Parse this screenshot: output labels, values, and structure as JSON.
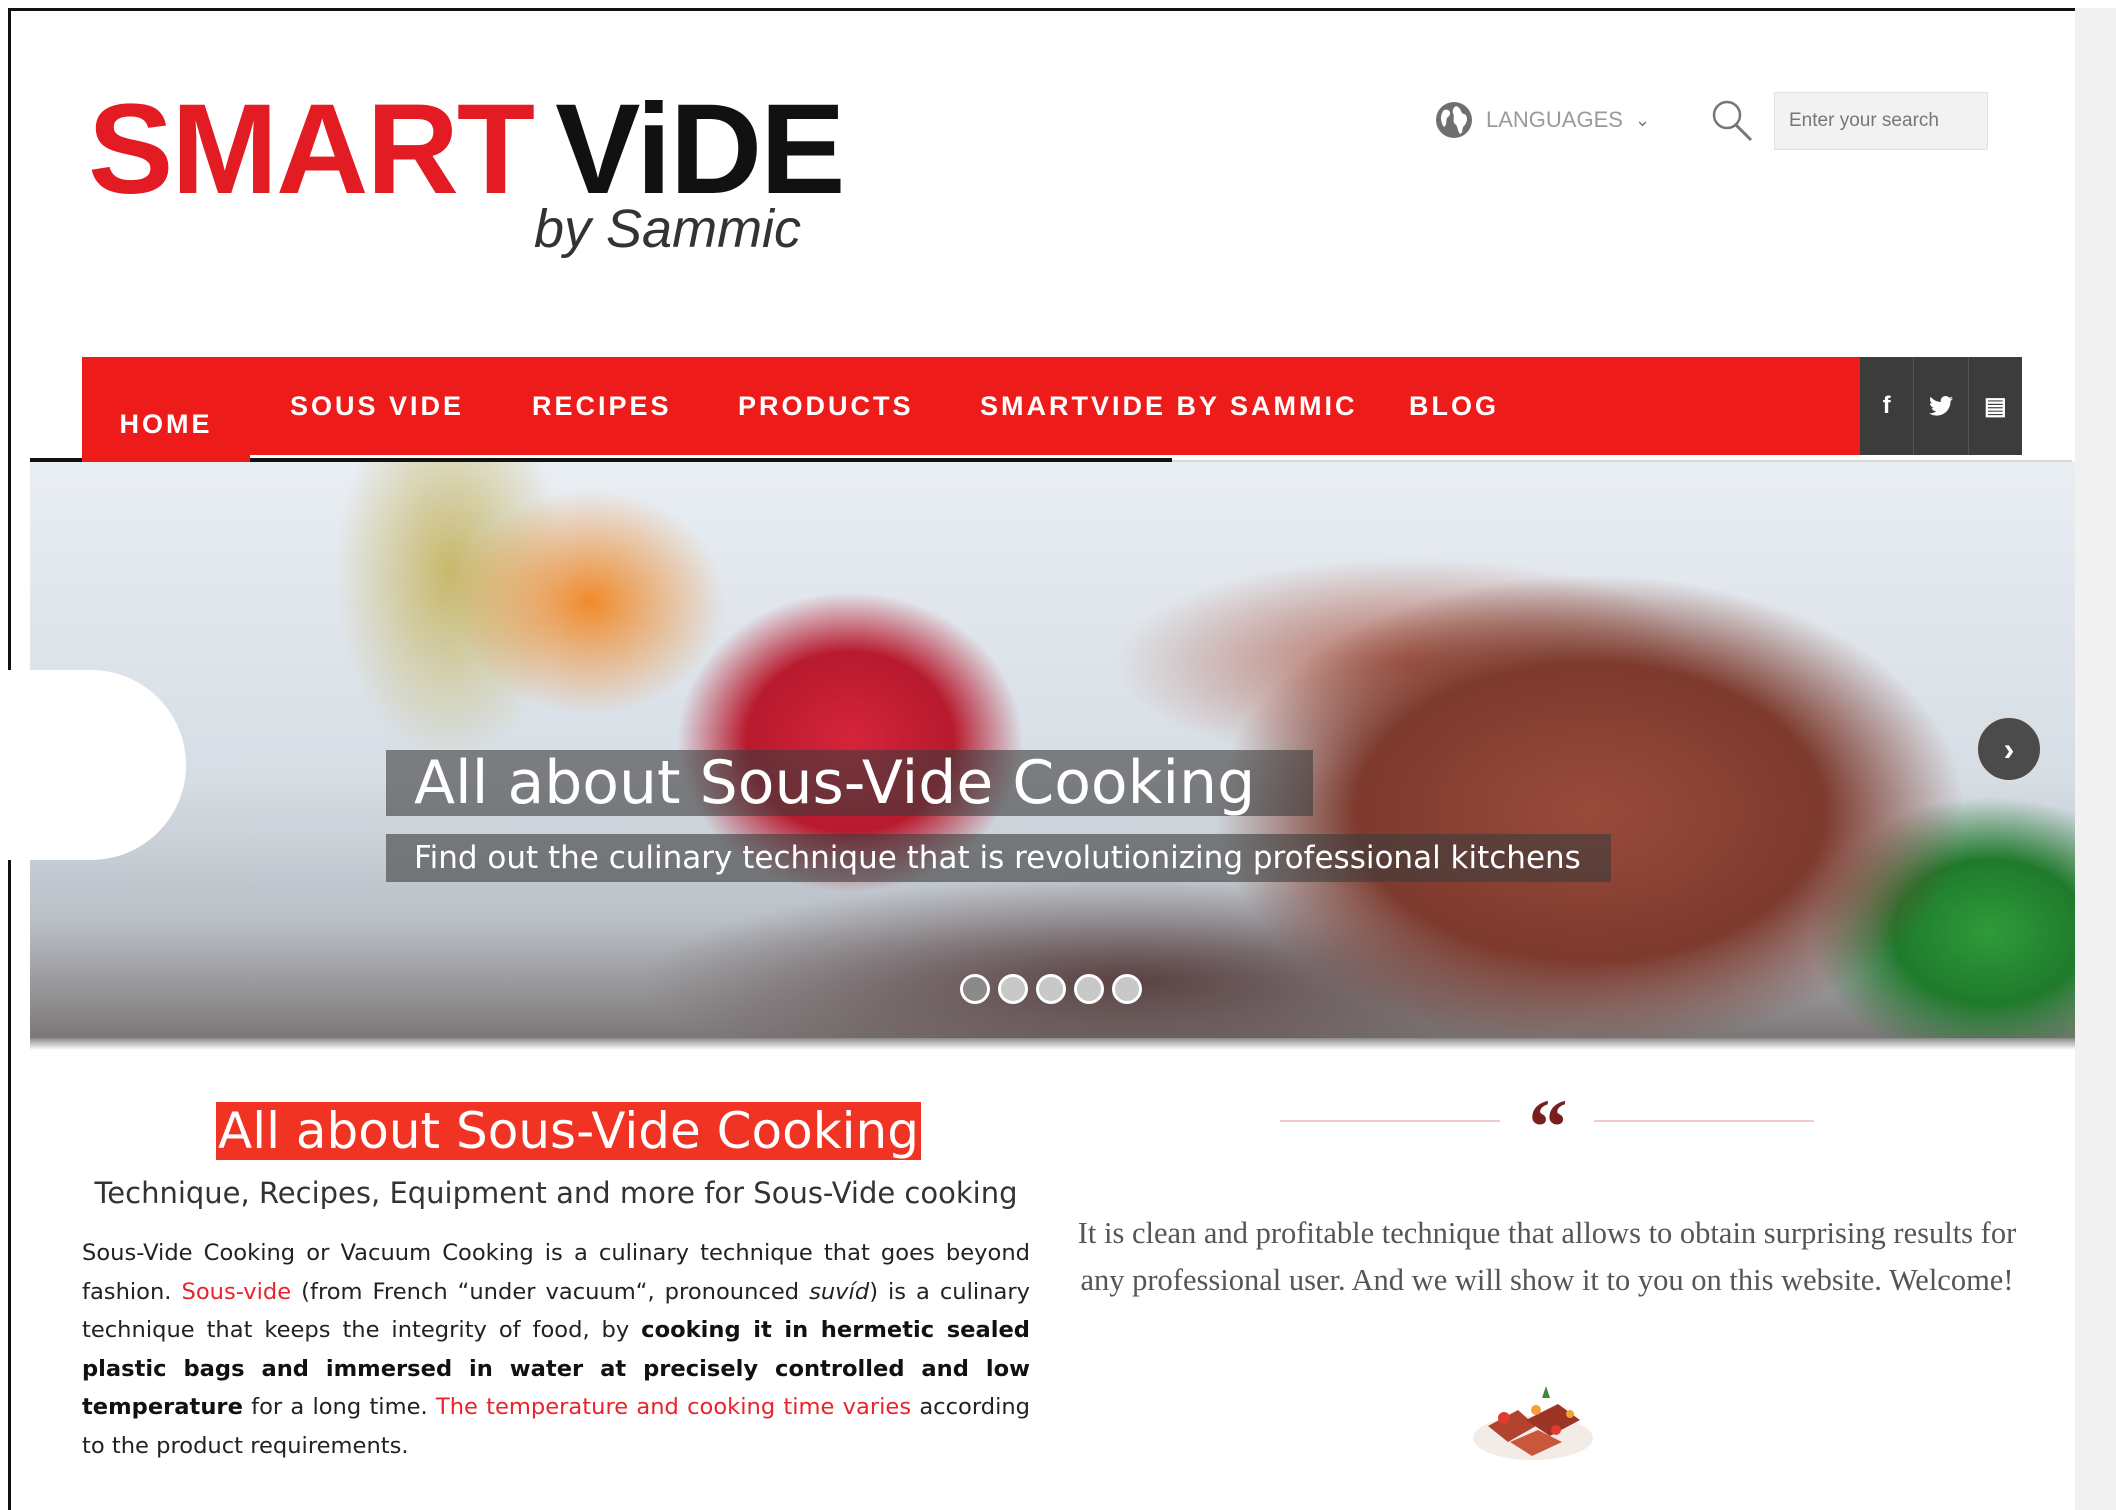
{
  "logo": {
    "brand_left": "SMART",
    "brand_right": "ViDE",
    "subtitle": "by Sammic"
  },
  "header": {
    "languages_label": "LANGUAGES",
    "search_placeholder": "Enter your search"
  },
  "nav": {
    "items": [
      {
        "label": "HOME",
        "active": true
      },
      {
        "label": "SOUS VIDE"
      },
      {
        "label": "RECIPES"
      },
      {
        "label": "PRODUCTS"
      },
      {
        "label": "SMARTVIDE BY SAMMIC"
      },
      {
        "label": "BLOG"
      }
    ],
    "social": [
      {
        "icon": "facebook-icon",
        "glyph": "f"
      },
      {
        "icon": "twitter-icon",
        "glyph": "t"
      },
      {
        "icon": "youtube-icon",
        "glyph": "▤"
      }
    ]
  },
  "hero": {
    "title": "All about Sous-Vide Cooking",
    "subtitle": "Find out the culinary technique that is revolutionizing professional kitchens",
    "next_glyph": "›",
    "slide_count": 5,
    "active_slide": 1
  },
  "intro": {
    "title": "All about Sous-Vide Cooking",
    "subtitle": "Technique, Recipes, Equipment and more for Sous-Vide cooking",
    "body": {
      "p1": "Sous-Vide Cooking or Vacuum Cooking is a culinary technique that goes beyond fashion. ",
      "link1": "Sous-vide",
      "p2": " (from French “under vacuum“, pronounced ",
      "pron": "suvíd",
      "p3": ") is a culinary technique that keeps the integrity of food, by ",
      "bold": "cooking it in hermetic sealed plastic bags and immersed in water at precisely controlled and low temperature",
      "p4": " for a long time. ",
      "link2": "The temperature and cooking time varies",
      "p5": " according to the product requirements."
    }
  },
  "quote": {
    "mark": "“",
    "text": "It is clean and profitable technique that allows to obtain surprising results for any professional user. And we will show it to you on this website. Welcome!"
  },
  "colors": {
    "brand_red": "#ee1b1b",
    "title_red": "#f03323",
    "dark": "#3c3c3c",
    "quote_mark": "#7a1f1f"
  }
}
